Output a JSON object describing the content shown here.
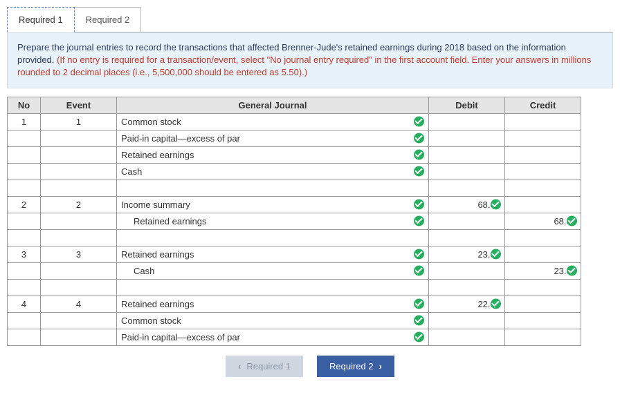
{
  "tabs": {
    "tab1": "Required 1",
    "tab2": "Required 2"
  },
  "instructions": {
    "main": "Prepare the journal entries to record the transactions that affected Brenner-Jude's retained earnings during 2018 based on the information provided. ",
    "red": "(If no entry is required for a transaction/event, select \"No journal entry required\" in the first account field. Enter your answers in millions rounded to 2 decimal places (i.e., 5,500,000 should be entered as 5.50).)"
  },
  "headers": {
    "no": "No",
    "event": "Event",
    "gj": "General Journal",
    "debit": "Debit",
    "credit": "Credit"
  },
  "rows": [
    {
      "no": "1",
      "event": "1",
      "gj": "Common stock",
      "debit": "",
      "credit": "",
      "indent": false,
      "hasCheck": true
    },
    {
      "no": "",
      "event": "",
      "gj": "Paid-in capital—excess of par",
      "debit": "",
      "credit": "",
      "indent": false,
      "hasCheck": true
    },
    {
      "no": "",
      "event": "",
      "gj": "Retained earnings",
      "debit": "",
      "credit": "",
      "indent": false,
      "hasCheck": true
    },
    {
      "no": "",
      "event": "",
      "gj": "Cash",
      "debit": "",
      "credit": "",
      "indent": false,
      "hasCheck": true
    },
    {
      "no": "",
      "event": "",
      "gj": "",
      "debit": "",
      "credit": "",
      "indent": false,
      "hasCheck": false
    },
    {
      "no": "2",
      "event": "2",
      "gj": "Income summary",
      "debit": "68.00",
      "credit": "",
      "indent": false,
      "hasCheck": true
    },
    {
      "no": "",
      "event": "",
      "gj": "Retained earnings",
      "debit": "",
      "credit": "68.00",
      "indent": true,
      "hasCheck": true
    },
    {
      "no": "",
      "event": "",
      "gj": "",
      "debit": "",
      "credit": "",
      "indent": false,
      "hasCheck": false
    },
    {
      "no": "3",
      "event": "3",
      "gj": "Retained earnings",
      "debit": "23.00",
      "credit": "",
      "indent": false,
      "hasCheck": true
    },
    {
      "no": "",
      "event": "",
      "gj": "Cash",
      "debit": "",
      "credit": "23.00",
      "indent": true,
      "hasCheck": true
    },
    {
      "no": "",
      "event": "",
      "gj": "",
      "debit": "",
      "credit": "",
      "indent": false,
      "hasCheck": false
    },
    {
      "no": "4",
      "event": "4",
      "gj": "Retained earnings",
      "debit": "22.00",
      "credit": "",
      "indent": false,
      "hasCheck": true
    },
    {
      "no": "",
      "event": "",
      "gj": "Common stock",
      "debit": "",
      "credit": "",
      "indent": false,
      "hasCheck": true
    },
    {
      "no": "",
      "event": "",
      "gj": "Paid-in capital—excess of par",
      "debit": "",
      "credit": "",
      "indent": false,
      "hasCheck": true
    }
  ],
  "nav": {
    "prev": "Required 1",
    "next": "Required 2"
  }
}
